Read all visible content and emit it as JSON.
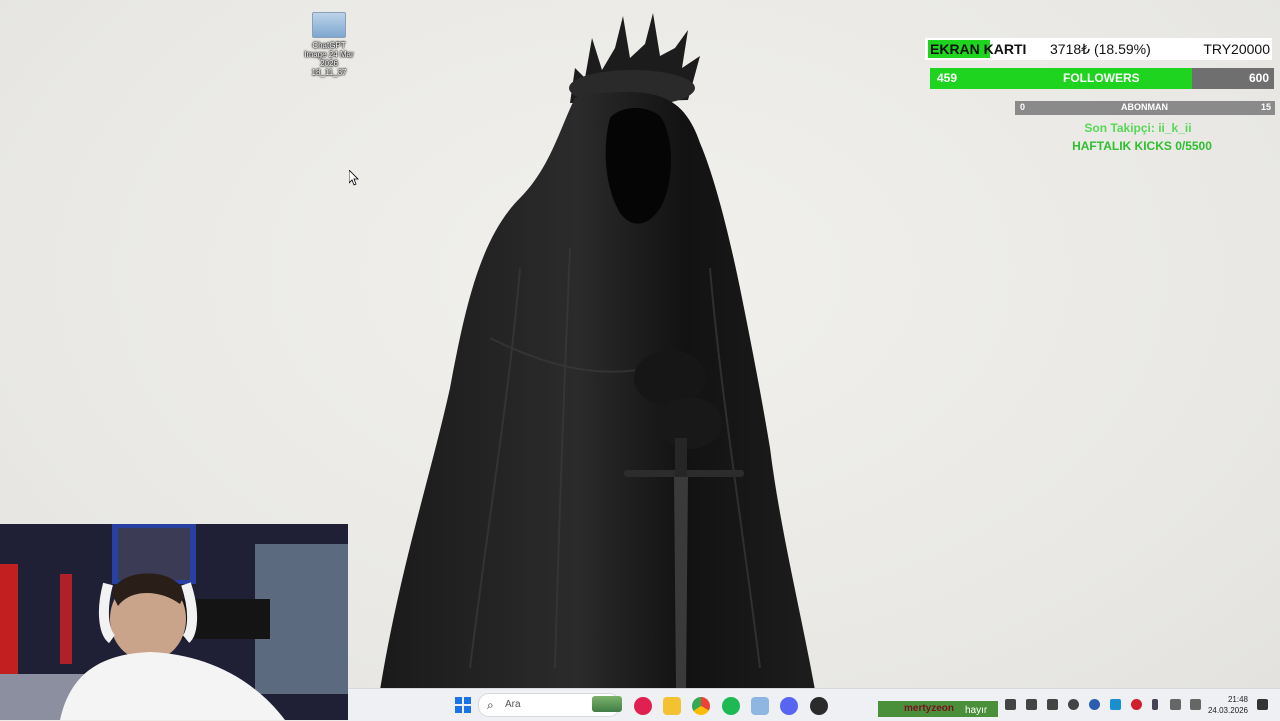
{
  "desktop_icon": {
    "label": "ChatGPT Image 24 Mar 2026 18_11_37"
  },
  "overlay": {
    "goal": {
      "title": "EKRAN KARTI",
      "amount": "3718₺ (18.59%)",
      "target": "TRY20000",
      "progress": 0.1859
    },
    "followers": {
      "current": "459",
      "label": "FOLLOWERS",
      "target": "600",
      "progress": 0.765
    },
    "abonman": {
      "current": "0",
      "label": "ABONMAN",
      "target": "15",
      "progress": 0
    },
    "son_takipci": "Son Takipçi: ii_k_ii",
    "haftalik": "HAFTALIK KICKS 0/5500"
  },
  "taskbar": {
    "search_placeholder": "Ara",
    "time": "21:48",
    "date": "24.03.2026",
    "kick_user": "mertyzeon",
    "kick_msg": "hayır"
  },
  "colors": {
    "goal_green": "#1ed41e",
    "text_green": "#58d858"
  },
  "icons": [
    "windows-start-icon",
    "search-icon",
    "widgets-icon",
    "media-icon",
    "file-explorer-icon",
    "chrome-icon",
    "spotify-icon",
    "app-icon",
    "discord-icon",
    "obs-icon"
  ]
}
